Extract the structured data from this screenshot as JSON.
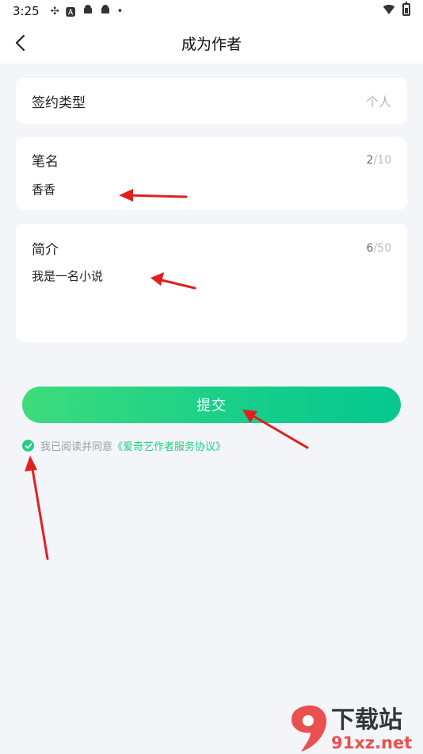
{
  "status_bar": {
    "time": "3:25",
    "icons": [
      "sync-icon",
      "font-icon",
      "android-icon",
      "android-icon",
      "dot-icon"
    ],
    "right_icons": [
      "wifi-icon",
      "battery-icon"
    ]
  },
  "header": {
    "title": "成为作者",
    "back_icon": "chevron-left-icon"
  },
  "form": {
    "sign_type": {
      "label": "签约类型",
      "value": "个人"
    },
    "pen_name": {
      "label": "笔名",
      "value": "香香",
      "count": "2",
      "max": "/10"
    },
    "intro": {
      "label": "简介",
      "value": "我是一名小说",
      "count": "6",
      "max": "/50"
    }
  },
  "submit": {
    "label": "提交"
  },
  "agreement": {
    "prefix": "我已阅读并同意",
    "link": "《爱奇艺作者服务协议》",
    "checked": true
  },
  "colors": {
    "accent": "#1fcf86",
    "background": "#f4f5f9",
    "annotation": "#e02020"
  },
  "watermark": {
    "logo_text": "9",
    "title": "下载站",
    "site": "91xz.net"
  }
}
